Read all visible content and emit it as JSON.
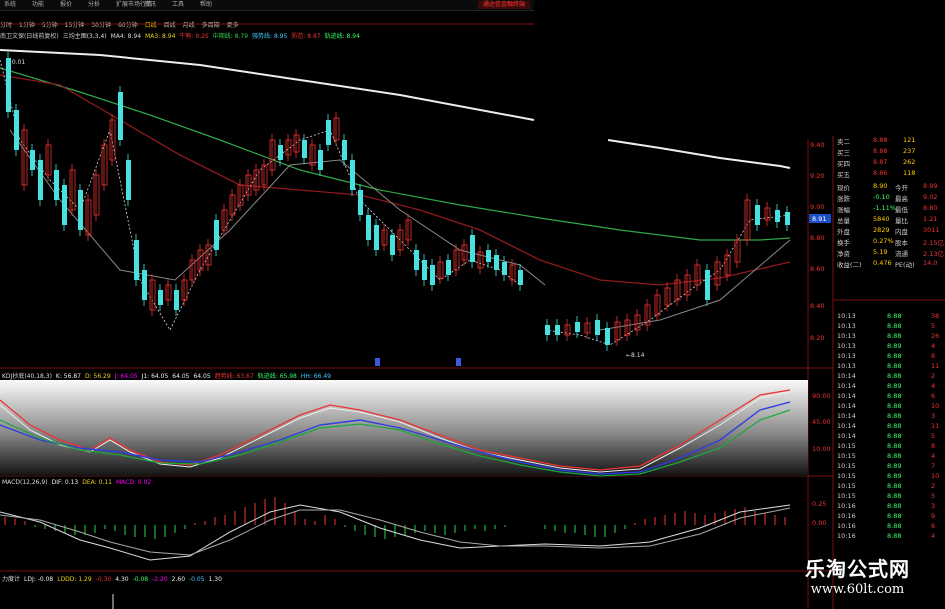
{
  "menu": [
    "系统",
    "功能",
    "报价",
    "分析",
    "扩展市场行情",
    "资讯",
    "工具",
    "帮助"
  ],
  "broker_logo": "通达信金融终端",
  "timeframes": [
    "分时",
    "1分钟",
    "5分钟",
    "15分钟",
    "30分钟",
    "60分钟",
    "日线",
    "周线",
    "月线",
    "多周期",
    "更多"
  ],
  "active_timeframe_index": 6,
  "stock": {
    "name": "南卫文保(日线前复权)",
    "main_indicator": "三均主图(3,3,4)",
    "ma_values": [
      {
        "label": "MA4:",
        "value": "8.94",
        "color": "#dddddd"
      },
      {
        "label": "MA3:",
        "value": "8.94",
        "color": "#f2d21b"
      },
      {
        "label": "牛熊:",
        "value": "9.25",
        "color": "#e33"
      },
      {
        "label": "中期线:",
        "value": "8.79",
        "color": "#2fd14c"
      },
      {
        "label": "强势线:",
        "value": "8.95",
        "color": "#3ec8ff"
      },
      {
        "label": "防范:",
        "value": "8.87",
        "color": "#e33"
      },
      {
        "label": "轨迹线:",
        "value": "8.94",
        "color": "#3f6"
      }
    ]
  },
  "price_labels": {
    "high": "10.01",
    "low": "8.14",
    "current_tag": "8.91"
  },
  "price_axis": [
    "9.40",
    "9.20",
    "9.00",
    "8.80",
    "8.60",
    "8.40",
    "8.20"
  ],
  "kdj": {
    "title": "KDJ抄底(40,18,3)",
    "values": [
      {
        "label": "K:",
        "value": "56.87",
        "color": "#eee"
      },
      {
        "label": "D:",
        "value": "56.29",
        "color": "#f2d21b"
      },
      {
        "label": "J:",
        "value": "64.05",
        "color": "#f0f"
      },
      {
        "label": "J1:",
        "value": "64.05",
        "color": "#eee"
      },
      {
        "label": "",
        "value": "64.05",
        "color": "#eee"
      },
      {
        "label": "",
        "value": "64.05",
        "color": "#eee"
      },
      {
        "label": "趋势线:",
        "value": "63.67",
        "color": "#e33"
      },
      {
        "label": "轨迹线:",
        "value": "65.98",
        "color": "#3f6"
      },
      {
        "label": "HH:",
        "value": "66.49",
        "color": "#3ec8ff"
      }
    ],
    "axis": [
      "90.00",
      "45.00",
      "10.00"
    ]
  },
  "macd": {
    "title": "MACD(12,26,9)",
    "values": [
      {
        "label": "DIF:",
        "value": "0.13",
        "color": "#eee"
      },
      {
        "label": "DEA:",
        "value": "0.11",
        "color": "#f2d21b"
      },
      {
        "label": "MACD:",
        "value": "0.02",
        "color": "#f0f"
      }
    ],
    "axis": [
      "0.25",
      "0.00"
    ]
  },
  "ldj": {
    "title": "力度计",
    "values": [
      {
        "label": "LDJ:",
        "value": "-0.08",
        "color": "#eee"
      },
      {
        "label": "LDDD:",
        "value": "1.29",
        "color": "#f2d21b"
      },
      {
        "label": "",
        "value": "-0.30",
        "color": "#e33"
      },
      {
        "label": "",
        "value": "4.30",
        "color": "#eee"
      },
      {
        "label": "",
        "value": "-0.08",
        "color": "#3f6"
      },
      {
        "label": "",
        "value": "-2.20",
        "color": "#f0f"
      },
      {
        "label": "",
        "value": "2.60",
        "color": "#eee"
      },
      {
        "label": "",
        "value": "-0.05",
        "color": "#3ec8ff"
      },
      {
        "label": "",
        "value": "1.30",
        "color": "#eee"
      }
    ]
  },
  "quote_top": [
    {
      "label": "卖二",
      "price": "8.88",
      "vol": "121"
    },
    {
      "label": "买三",
      "price": "8.88",
      "vol": "237"
    },
    {
      "label": "买四",
      "price": "8.87",
      "vol": "262"
    },
    {
      "label": "买五",
      "price": "8.86",
      "vol": "118"
    }
  ],
  "quote_stats": [
    {
      "l1": "现价",
      "v1": "8.90",
      "l2": "今开",
      "v2": "8.99"
    },
    {
      "l1": "涨跌",
      "v1": "-0.10",
      "l2": "最高",
      "v2": "9.02"
    },
    {
      "l1": "涨幅",
      "v1": "-1.11%",
      "l2": "最低",
      "v2": "8.80"
    },
    {
      "l1": "总量",
      "v1": "5840",
      "l2": "量比",
      "v2": "1.21"
    },
    {
      "l1": "外盘",
      "v1": "2829",
      "l2": "内盘",
      "v2": "3011"
    },
    {
      "l1": "换手",
      "v1": "0.27%",
      "l2": "股本",
      "v2": "2.15亿"
    },
    {
      "l1": "净资",
      "v1": "5.19",
      "l2": "流通",
      "v2": "2.13亿"
    },
    {
      "l1": "收益(二)",
      "v1": "0.476",
      "l2": "PE(动)",
      "v2": "14.0"
    }
  ],
  "ticks": [
    {
      "t": "10:13",
      "p": "8.88",
      "v": "38"
    },
    {
      "t": "10:13",
      "p": "8.88",
      "v": "5"
    },
    {
      "t": "10:13",
      "p": "8.88",
      "v": "26"
    },
    {
      "t": "10:13",
      "p": "8.89",
      "v": "4"
    },
    {
      "t": "10:13",
      "p": "8.88",
      "v": "8"
    },
    {
      "t": "10:13",
      "p": "8.88",
      "v": "11"
    },
    {
      "t": "10:14",
      "p": "8.88",
      "v": "2"
    },
    {
      "t": "10:14",
      "p": "8.89",
      "v": "4"
    },
    {
      "t": "10:14",
      "p": "8.88",
      "v": "6"
    },
    {
      "t": "10:14",
      "p": "8.88",
      "v": "10"
    },
    {
      "t": "10:14",
      "p": "8.88",
      "v": "3"
    },
    {
      "t": "10:14",
      "p": "8.88",
      "v": "11"
    },
    {
      "t": "10:14",
      "p": "8.88",
      "v": "5"
    },
    {
      "t": "10:15",
      "p": "8.88",
      "v": "8"
    },
    {
      "t": "10:15",
      "p": "8.88",
      "v": "4"
    },
    {
      "t": "10:15",
      "p": "8.89",
      "v": "7"
    },
    {
      "t": "10:15",
      "p": "8.89",
      "v": "10"
    },
    {
      "t": "10:15",
      "p": "8.88",
      "v": "2"
    },
    {
      "t": "10:15",
      "p": "8.88",
      "v": "5"
    },
    {
      "t": "10:16",
      "p": "8.88",
      "v": "3"
    },
    {
      "t": "10:16",
      "p": "8.88",
      "v": "9"
    },
    {
      "t": "10:16",
      "p": "8.88",
      "v": "6"
    },
    {
      "t": "10:16",
      "p": "8.88",
      "v": "4"
    }
  ],
  "watermark": {
    "line1": "乐淘公式网",
    "line2": "www.60lt.com"
  }
}
